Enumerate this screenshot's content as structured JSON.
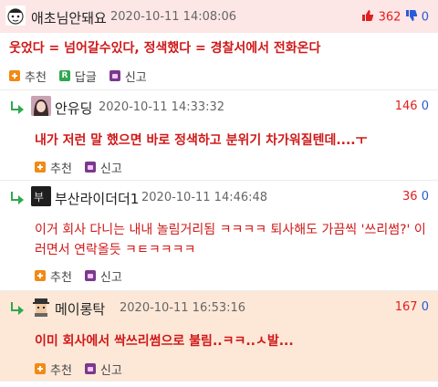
{
  "comments": [
    {
      "nick": "애초님안돼요",
      "date": "2020-10-11 14:08:06",
      "up": "362",
      "down": "0",
      "text": "웃었다 = 넘어갈수있다, 정색했다 = 경찰서에서 전화온다",
      "actions": {
        "recommend": "추천",
        "reply": "답글",
        "report": "신고"
      }
    },
    {
      "nick": "안유딩",
      "date": "2020-10-11 14:33:32",
      "up": "146",
      "down": "0",
      "text": "내가 저런 말 했으면 바로 정색하고 분위기 차가워질텐데....ㅜ",
      "actions": {
        "recommend": "추천",
        "report": "신고"
      }
    },
    {
      "nick": "부산라이더더1",
      "date": "2020-10-11 14:46:48",
      "up": "36",
      "down": "0",
      "text": "이거 회사 다니는 내내 놀림거리됨 ㅋㅋㅋㅋ 퇴사해도 가끔씩 '쓰리썸?' 이러면서 연락올듯 ㅋㅌㅋㅋㅋㅋ",
      "actions": {
        "recommend": "추천",
        "report": "신고"
      }
    },
    {
      "nick": "메이롱탁",
      "date": "2020-10-11 16:53:16",
      "up": "167",
      "down": "0",
      "text": "이미 회사에서 싹쓰리썸으로 불림..ㅋㅋ..ㅅ발...",
      "actions": {
        "recommend": "추천",
        "report": "신고"
      }
    }
  ],
  "colors": {
    "best_bg": "#fde6e6",
    "reply_bg": "#ffffff",
    "best_reply_bg": "#fde8d8",
    "text_red": "#d01818",
    "up": "#e02020",
    "down": "#2a5ad8"
  }
}
